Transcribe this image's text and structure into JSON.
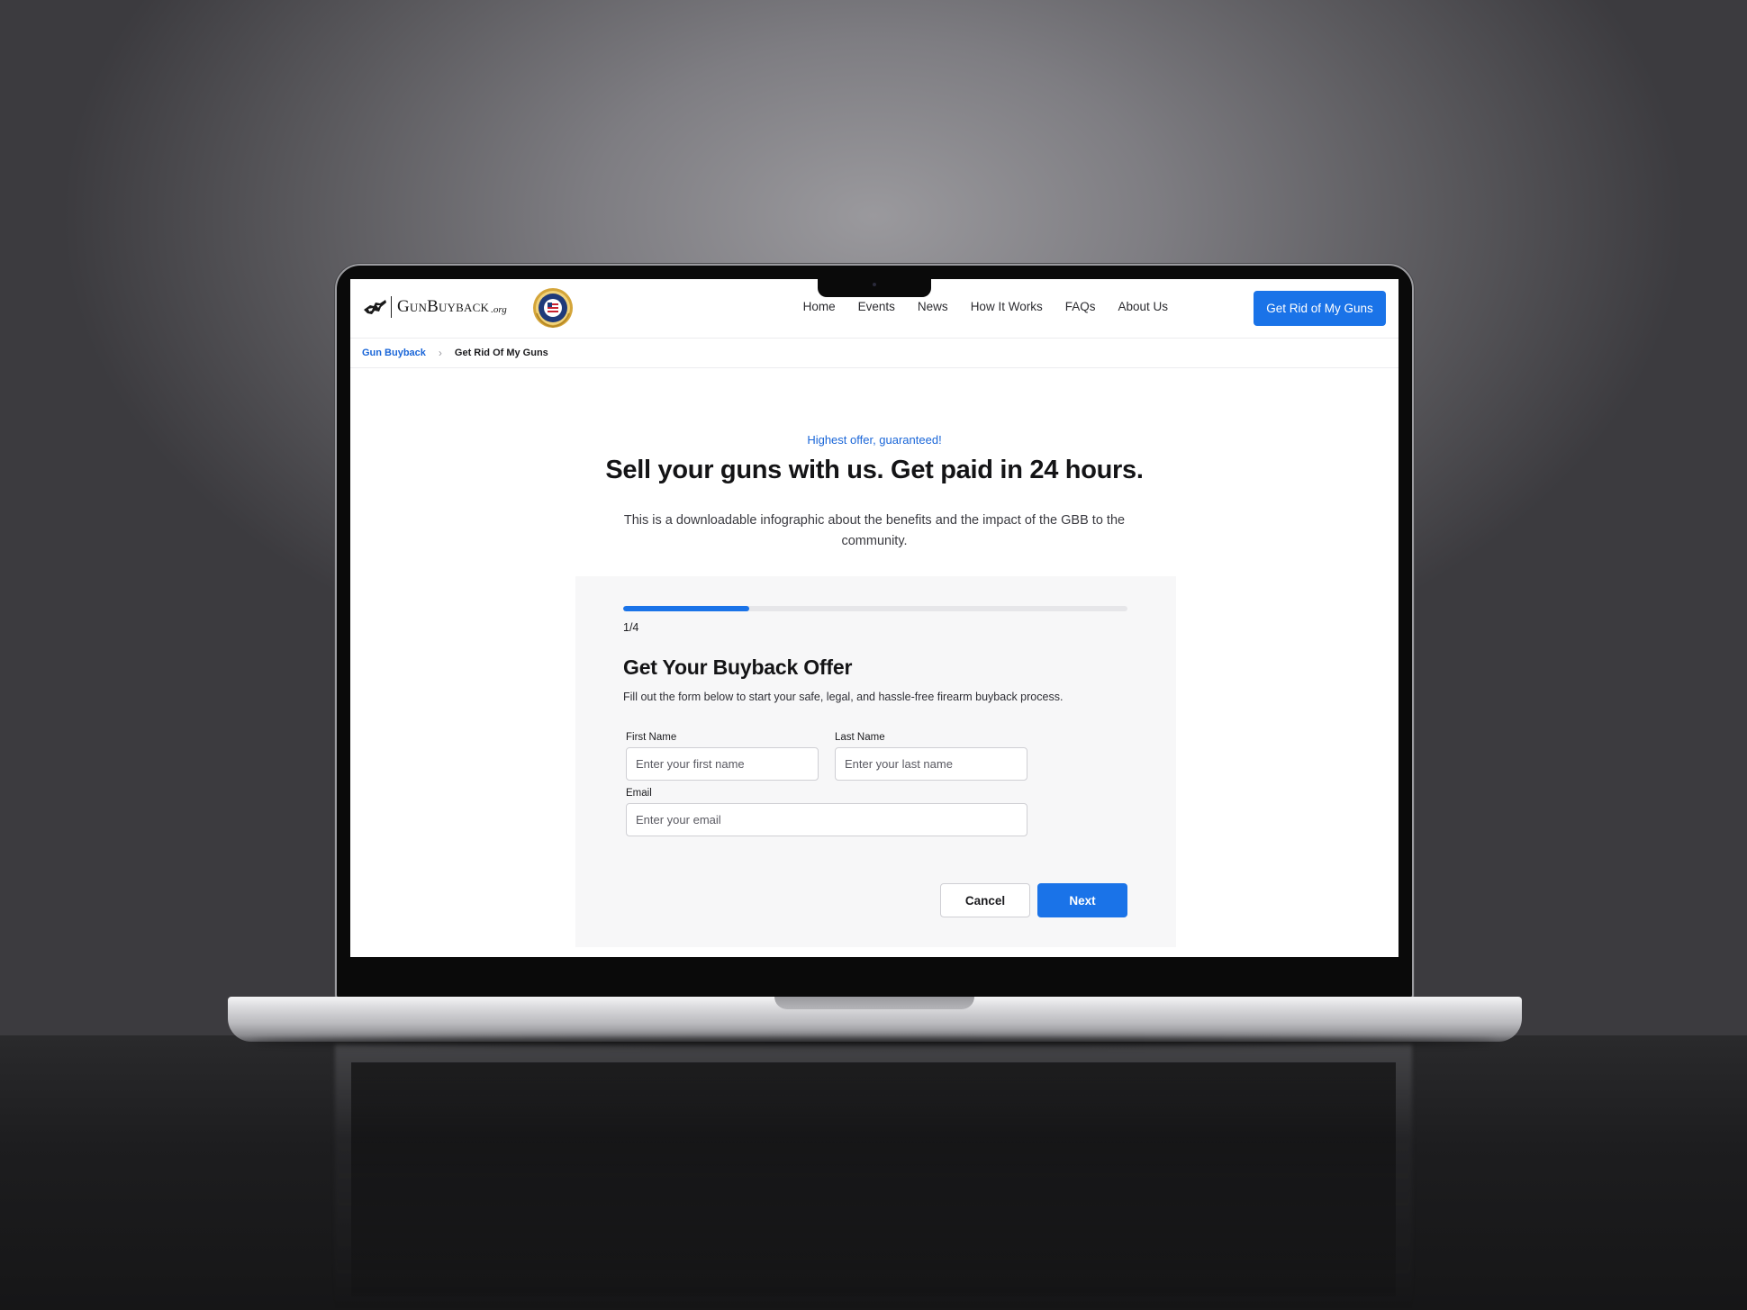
{
  "brand": {
    "name": "GunBuyback",
    "suffix": ".org",
    "accent": "#1a73e8"
  },
  "nav": {
    "links": [
      "Home",
      "Events",
      "News",
      "How It Works",
      "FAQs",
      "About Us"
    ],
    "cta_label": "Get Rid of My Guns"
  },
  "breadcrumb": {
    "root": "Gun Buyback",
    "current": "Get Rid Of My Guns"
  },
  "hero": {
    "eyebrow": "Highest offer, guaranteed!",
    "headline": "Sell your guns with us. Get paid in 24 hours.",
    "lede": "This is a downloadable infographic about the benefits and the impact of the GBB to the community."
  },
  "form": {
    "progress": 0.25,
    "step_label": "1/4",
    "title": "Get Your Buyback Offer",
    "subtitle": "Fill out the form below to start your safe, legal, and hassle-free firearm buyback process.",
    "first_name": {
      "label": "First Name",
      "placeholder": "Enter your first name",
      "value": ""
    },
    "last_name": {
      "label": "Last Name",
      "placeholder": "Enter your last name",
      "value": ""
    },
    "email": {
      "label": "Email",
      "placeholder": "Enter your email",
      "value": ""
    },
    "cancel_label": "Cancel",
    "next_label": "Next"
  }
}
